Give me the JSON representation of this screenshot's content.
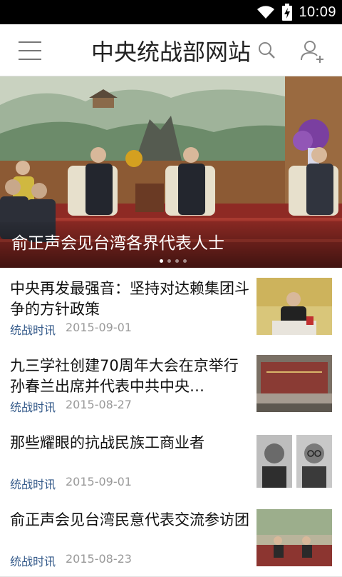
{
  "status_bar": {
    "time": "10:09"
  },
  "header": {
    "title": "中央统战部网站"
  },
  "banner": {
    "caption": "俞正声会见台湾各界代表人士",
    "slide_count": 4,
    "active_slide": 1
  },
  "news": [
    {
      "title": "中央再发最强音：坚持对达赖集团斗争的方针政策",
      "category": "统战时讯",
      "date": "2015-09-01"
    },
    {
      "title": "九三学社创建70周年大会在京举行 孙春兰出席并代表中共中央…",
      "category": "统战时讯",
      "date": "2015-08-27"
    },
    {
      "title": "那些耀眼的抗战民族工商业者",
      "category": "统战时讯",
      "date": "2015-09-01"
    },
    {
      "title": "俞正声会见台湾民意代表交流参访团",
      "category": "统战时讯",
      "date": "2015-08-23"
    }
  ]
}
